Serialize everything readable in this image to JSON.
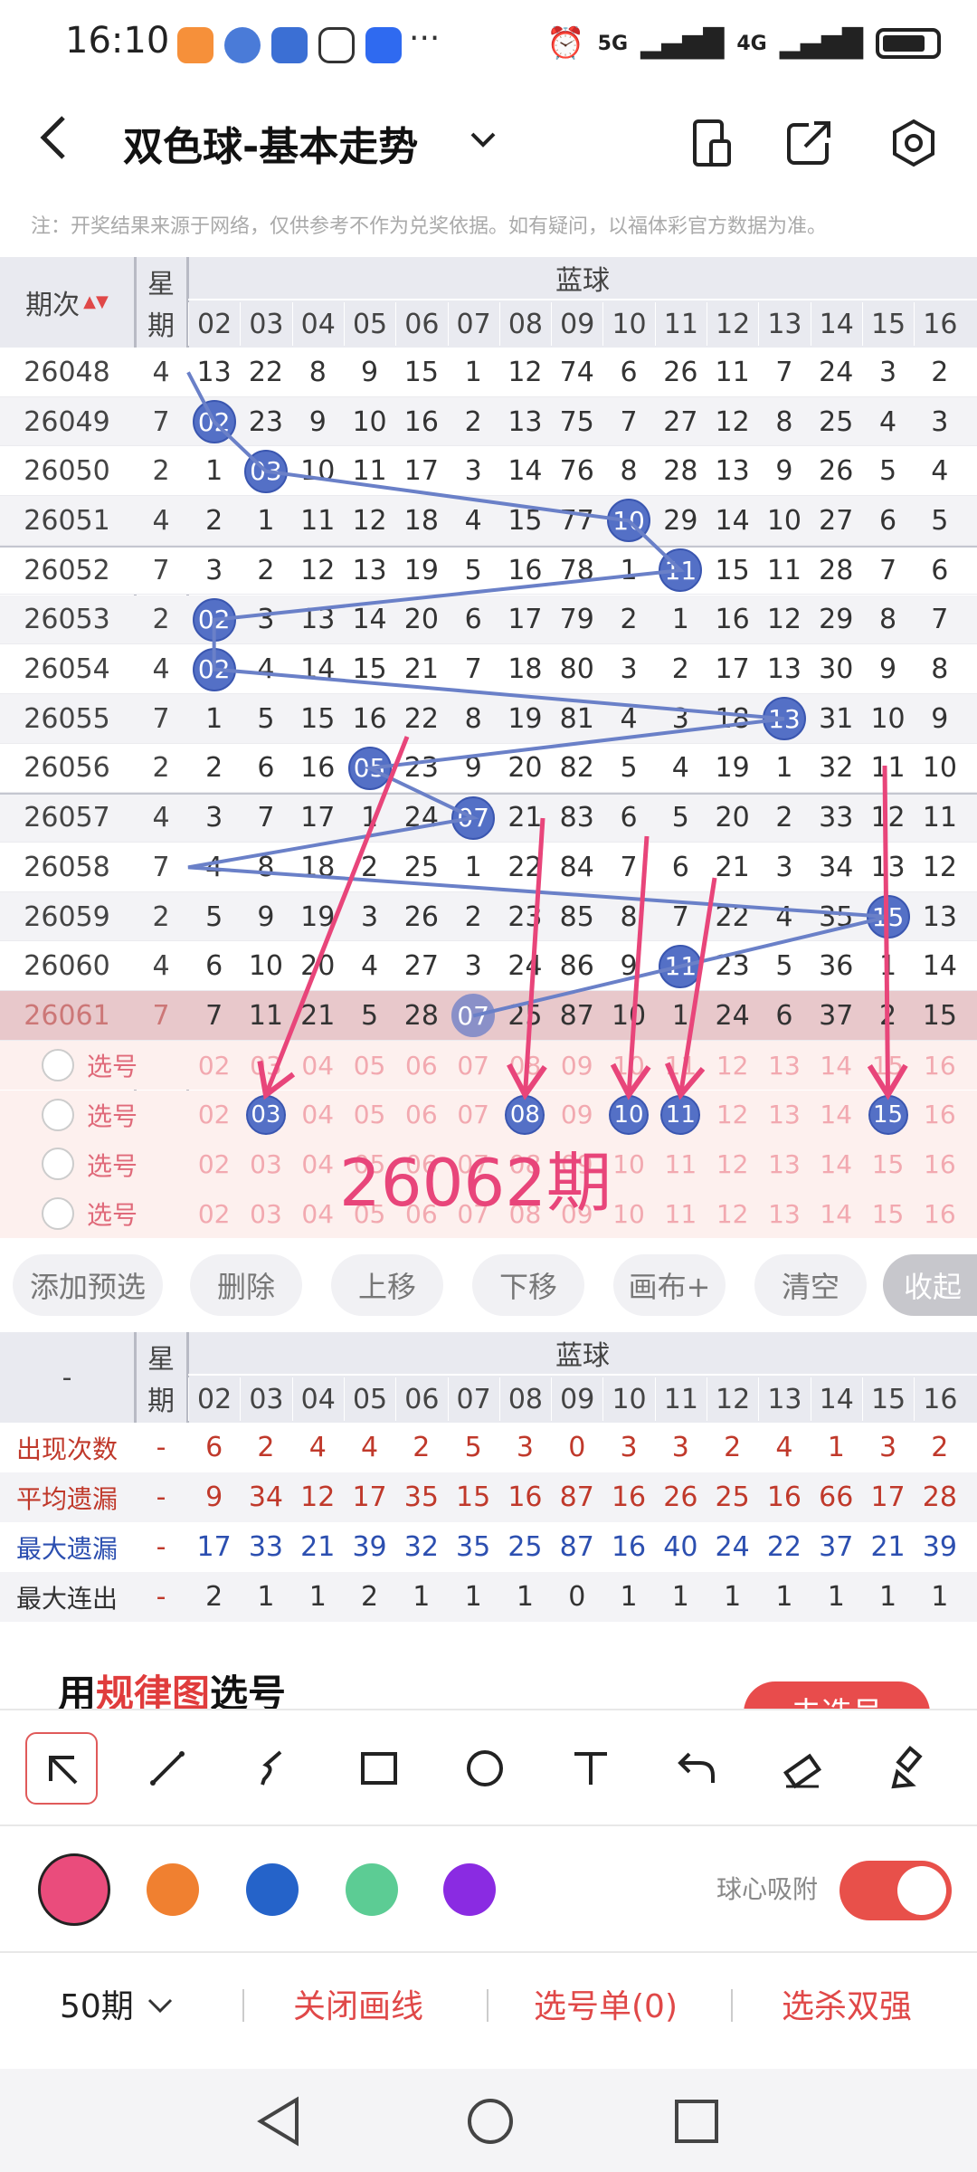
{
  "status_bar": {
    "time": "16:10",
    "signal1": "5G",
    "signal2": "4G",
    "more": "···"
  },
  "header": {
    "title": "双色球-基本走势",
    "back_icon": "chevron-left-icon"
  },
  "notice": "注：开奖结果来源于网络，仅供参考不作为兑奖依据。如有疑问，以福体彩官方数据为准。",
  "table": {
    "col_period": "期次",
    "col_week_top": "星",
    "col_week_bottom": "期",
    "group_label": "蓝球",
    "numbers": [
      "02",
      "03",
      "04",
      "05",
      "06",
      "07",
      "08",
      "09",
      "10",
      "11",
      "12",
      "13",
      "14",
      "15",
      "16"
    ],
    "rows": [
      {
        "period": "26048",
        "week": "4",
        "cells": [
          "13",
          "22",
          "8",
          "9",
          "15",
          "1",
          "12",
          "74",
          "6",
          "26",
          "11",
          "7",
          "24",
          "3",
          "2"
        ],
        "hit": null
      },
      {
        "period": "26049",
        "week": "7",
        "cells": [
          "02",
          "23",
          "9",
          "10",
          "16",
          "2",
          "13",
          "75",
          "7",
          "27",
          "12",
          "8",
          "25",
          "4",
          "3"
        ],
        "hit": 0
      },
      {
        "period": "26050",
        "week": "2",
        "cells": [
          "1",
          "03",
          "10",
          "11",
          "17",
          "3",
          "14",
          "76",
          "8",
          "28",
          "13",
          "9",
          "26",
          "5",
          "4"
        ],
        "hit": 1
      },
      {
        "period": "26051",
        "week": "4",
        "cells": [
          "2",
          "1",
          "11",
          "12",
          "18",
          "4",
          "15",
          "77",
          "10",
          "29",
          "14",
          "10",
          "27",
          "6",
          "5"
        ],
        "hit": 8
      },
      {
        "period": "26052",
        "week": "7",
        "cells": [
          "3",
          "2",
          "12",
          "13",
          "19",
          "5",
          "16",
          "78",
          "1",
          "11",
          "15",
          "11",
          "28",
          "7",
          "6"
        ],
        "hit": 9
      },
      {
        "period": "26053",
        "week": "2",
        "cells": [
          "02",
          "3",
          "13",
          "14",
          "20",
          "6",
          "17",
          "79",
          "2",
          "1",
          "16",
          "12",
          "29",
          "8",
          "7"
        ],
        "hit": 0
      },
      {
        "period": "26054",
        "week": "4",
        "cells": [
          "02",
          "4",
          "14",
          "15",
          "21",
          "7",
          "18",
          "80",
          "3",
          "2",
          "17",
          "13",
          "30",
          "9",
          "8"
        ],
        "hit": 0
      },
      {
        "period": "26055",
        "week": "7",
        "cells": [
          "1",
          "5",
          "15",
          "16",
          "22",
          "8",
          "19",
          "81",
          "4",
          "3",
          "18",
          "13",
          "31",
          "10",
          "9"
        ],
        "hit": 11
      },
      {
        "period": "26056",
        "week": "2",
        "cells": [
          "2",
          "6",
          "16",
          "05",
          "23",
          "9",
          "20",
          "82",
          "5",
          "4",
          "19",
          "1",
          "32",
          "11",
          "10"
        ],
        "hit": 3
      },
      {
        "period": "26057",
        "week": "4",
        "cells": [
          "3",
          "7",
          "17",
          "1",
          "24",
          "07",
          "21",
          "83",
          "6",
          "5",
          "20",
          "2",
          "33",
          "12",
          "11"
        ],
        "hit": 5
      },
      {
        "period": "26058",
        "week": "7",
        "cells": [
          "4",
          "8",
          "18",
          "2",
          "25",
          "1",
          "22",
          "84",
          "7",
          "6",
          "21",
          "3",
          "34",
          "13",
          "12"
        ],
        "hit": null
      },
      {
        "period": "26059",
        "week": "2",
        "cells": [
          "5",
          "9",
          "19",
          "3",
          "26",
          "2",
          "23",
          "85",
          "8",
          "7",
          "22",
          "4",
          "35",
          "15",
          "13"
        ],
        "hit": 13
      },
      {
        "period": "26060",
        "week": "4",
        "cells": [
          "6",
          "10",
          "20",
          "4",
          "27",
          "3",
          "24",
          "86",
          "9",
          "11",
          "23",
          "5",
          "36",
          "1",
          "14"
        ],
        "hit": 9
      },
      {
        "period": "26061",
        "week": "7",
        "cells": [
          "7",
          "11",
          "21",
          "5",
          "28",
          "07",
          "25",
          "87",
          "10",
          "1",
          "24",
          "6",
          "37",
          "2",
          "15"
        ],
        "hit": 5
      }
    ],
    "pick_label": "选号",
    "selected_balls": [
      "03",
      "08",
      "10",
      "11",
      "15"
    ],
    "annotation_text": "26062期"
  },
  "buttons": [
    "添加预选",
    "删除",
    "上移",
    "下移",
    "画布+",
    "清空",
    "收起"
  ],
  "stats": {
    "dash": "-",
    "rows": [
      {
        "label": "出现次数",
        "dash": "-",
        "values": [
          "6",
          "2",
          "4",
          "4",
          "2",
          "5",
          "3",
          "0",
          "3",
          "3",
          "2",
          "4",
          "1",
          "3",
          "2"
        ]
      },
      {
        "label": "平均遗漏",
        "dash": "-",
        "values": [
          "9",
          "34",
          "12",
          "17",
          "35",
          "15",
          "16",
          "87",
          "16",
          "26",
          "25",
          "16",
          "66",
          "17",
          "28"
        ]
      },
      {
        "label": "最大遗漏",
        "dash": "-",
        "values": [
          "17",
          "33",
          "21",
          "39",
          "32",
          "35",
          "25",
          "87",
          "16",
          "40",
          "24",
          "22",
          "37",
          "21",
          "39"
        ]
      },
      {
        "label": "最大连出",
        "dash": "-",
        "values": [
          "2",
          "1",
          "1",
          "2",
          "1",
          "1",
          "1",
          "0",
          "1",
          "1",
          "1",
          "1",
          "1",
          "1",
          "1"
        ]
      }
    ]
  },
  "promo": {
    "prefix": "用",
    "highlight": "规律图",
    "suffix": "选号",
    "button": "去选号"
  },
  "tools": [
    "arrow-tool-icon",
    "line-tool-icon",
    "curve-tool-icon",
    "rectangle-tool-icon",
    "circle-tool-icon",
    "text-tool-icon",
    "undo-icon",
    "eraser-icon",
    "clear-brush-icon"
  ],
  "colors": [
    "#ea4c7c",
    "#f08030",
    "#2563c9",
    "#5ccc94",
    "#8a2be2"
  ],
  "snap": {
    "label": "球心吸附",
    "on": true
  },
  "bottom": {
    "periods": "50期",
    "close_line": "关闭画线",
    "pick_list": "选号单(0)",
    "kill": "选杀双强"
  },
  "accent": "#e04848",
  "ball_color": "#5470c6",
  "pink": "#e8457a"
}
